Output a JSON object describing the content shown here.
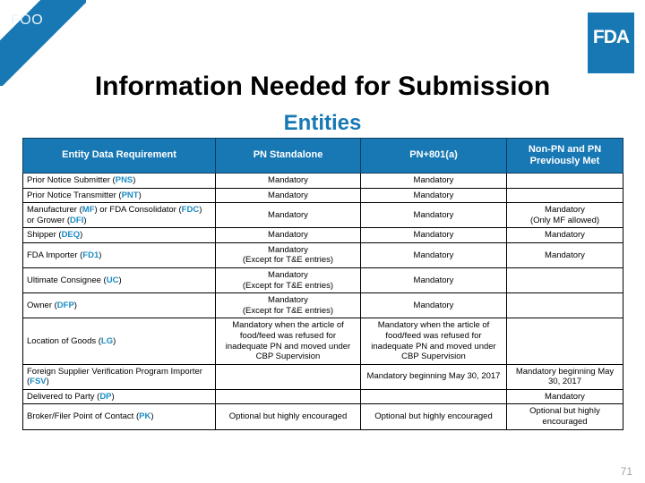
{
  "branding": {
    "corner_banner_label": "FOO",
    "corner_banner_color": "#1878b4",
    "logo_text": "FDA",
    "logo_color": "#1878b4"
  },
  "slide": {
    "title": "Information Needed for Submission",
    "subtitle": "Entities",
    "subtitle_color": "#1878b4",
    "number": "71"
  },
  "table": {
    "headers": [
      "Entity Data Requirement",
      "PN Standalone",
      "PN+801(a)",
      "Non-PN and PN Previously Met"
    ],
    "abbr_color": "#1b8bc4",
    "rows": [
      {
        "requirement": "Prior Notice Submitter (PNS)",
        "requirement_label": "Prior Notice Submitter (",
        "requirement_abbr": "PNS",
        "requirement_tail": ")",
        "pn_standalone": "Mandatory",
        "pn_801a": "Mandatory",
        "non_pn": ""
      },
      {
        "requirement": "Prior Notice Transmitter (PNT)",
        "requirement_label": "Prior Notice Transmitter (",
        "requirement_abbr": "PNT",
        "requirement_tail": ")",
        "pn_standalone": "Mandatory",
        "pn_801a": "Mandatory",
        "non_pn": ""
      },
      {
        "requirement": "Manufacturer (MF) or FDA Consolidator (FDC) or Grower (DFI)",
        "requirement_label": "Manufacturer (",
        "requirement_abbr": "MF",
        "requirement_tail": ") or FDA Consolidator (",
        "requirement_abbr2": "FDC",
        "requirement_tail2": ") or Grower (",
        "requirement_abbr3": "DFI",
        "requirement_tail3": ")",
        "pn_standalone": "Mandatory",
        "pn_801a": "Mandatory",
        "non_pn": "Mandatory\n(Only MF allowed)"
      },
      {
        "requirement": "Shipper (DEQ)",
        "requirement_label": "Shipper (",
        "requirement_abbr": "DEQ",
        "requirement_tail": ")",
        "pn_standalone": "Mandatory",
        "pn_801a": "Mandatory",
        "non_pn": "Mandatory"
      },
      {
        "requirement": "FDA Importer (FD1)",
        "requirement_label": "FDA Importer (",
        "requirement_abbr": "FD1",
        "requirement_tail": ")",
        "pn_standalone": "Mandatory\n(Except for T&E entries)",
        "pn_801a": "Mandatory",
        "non_pn": "Mandatory"
      },
      {
        "requirement": "Ultimate Consignee (UC)",
        "requirement_label": "Ultimate Consignee (",
        "requirement_abbr": "UC",
        "requirement_tail": ")",
        "pn_standalone": "Mandatory\n(Except for T&E entries)",
        "pn_801a": "Mandatory",
        "non_pn": ""
      },
      {
        "requirement": "Owner (DFP)",
        "requirement_label": "Owner (",
        "requirement_abbr": "DFP",
        "requirement_tail": ")",
        "pn_standalone": "Mandatory\n(Except for T&E entries)",
        "pn_801a": "Mandatory",
        "non_pn": ""
      },
      {
        "requirement": "Location of Goods (LG)",
        "requirement_label": "Location of Goods (",
        "requirement_abbr": "LG",
        "requirement_tail": ")",
        "pn_standalone": "Mandatory when the article of food/feed was refused for inadequate PN and moved under CBP Supervision",
        "pn_801a": "Mandatory when the article of food/feed was refused for inadequate PN and moved under CBP Supervision",
        "non_pn": ""
      },
      {
        "requirement": "Foreign Supplier Verification Program Importer (FSV)",
        "requirement_label": "Foreign Supplier Verification Program Importer (",
        "requirement_abbr": "FSV",
        "requirement_tail": ")",
        "pn_standalone": "",
        "pn_801a": "Mandatory beginning May 30, 2017",
        "non_pn": "Mandatory beginning May 30, 2017"
      },
      {
        "requirement": "Delivered to Party (DP)",
        "requirement_label": "Delivered to Party (",
        "requirement_abbr": "DP",
        "requirement_tail": ")",
        "pn_standalone": "",
        "pn_801a": "",
        "non_pn": "Mandatory"
      },
      {
        "requirement": "Broker/Filer Point of Contact (PK)",
        "requirement_label": "Broker/Filer Point of Contact (",
        "requirement_abbr": "PK",
        "requirement_tail": ")",
        "pn_standalone": "Optional but highly encouraged",
        "pn_801a": "Optional but highly encouraged",
        "non_pn": "Optional but highly encouraged"
      }
    ]
  }
}
